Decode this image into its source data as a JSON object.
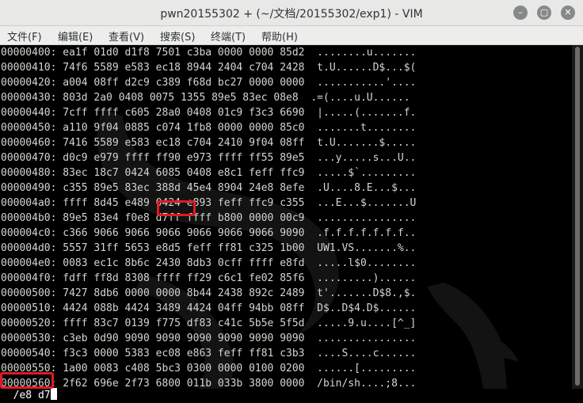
{
  "window": {
    "title": "pwn20155302 + (~/文档/20155302/exp1) - VIM"
  },
  "controls": {
    "minimize": "–",
    "maximize": "▢",
    "close": "✕"
  },
  "menu": [
    "文件(F)",
    "编辑(E)",
    "查看(V)",
    "搜索(S)",
    "终端(T)",
    "帮助(H)"
  ],
  "hexdump": [
    "00000400: ea1f 01d0 d1f8 7501 c3ba 0000 0000 85d2  ........u.......",
    "00000410: 74f6 5589 e583 ec18 8944 2404 c704 2428  t.U......D$...$(",
    "00000420: a004 08ff d2c9 c389 f68d bc27 0000 0000  ...........'....",
    "00000430: 803d 2a0 0408 0075 1355 89e5 83ec 08e8  .=(....u.U......",
    "00000440: 7cff ffff c605 28a0 0408 01c9 f3c3 6690  |.....(.......f.",
    "00000450: a110 9f04 0885 c074 1fb8 0000 0000 85c0  .......t........",
    "00000460: 7416 5589 e583 ec18 c704 2410 9f04 08ff  t.U.......$.....",
    "00000470: d0c9 e979 ffff ff90 e973 ffff ff55 89e5  ...y.....s...U..",
    "00000480: 83ec 18c7 0424 6085 0408 e8c1 feff ffc9  .....$`.........",
    "00000490: c355 89e5 83ec 388d 45e4 8904 24e8 8efe  .U....8.E...$...",
    "000004a0: ffff 8d45 e489 0424 e893 feff ffc9 c355  ...E...$.......U",
    "000004b0: 89e5 83e4 f0e8 d7ff ffff b800 0000 00c9  ................",
    "000004c0: c366 9066 9066 9066 9066 9066 9066 9090  .f.f.f.f.f.f.f..",
    "000004d0: 5557 31ff 5653 e8d5 feff ff81 c325 1b00  UW1.VS.......%..",
    "000004e0: 0083 ec1c 8b6c 2430 8db3 0cff ffff e8fd  .....l$0........",
    "000004f0: fdff ff8d 8308 ffff ff29 c6c1 fe02 85f6  .........)......",
    "00000500: 7427 8db6 0000 0000 8b44 2438 892c 2489  t'.......D$8.,$.",
    "00000510: 4424 088b 4424 3489 4424 04ff 94bb 08ff  D$..D$4.D$......",
    "00000520: ffff 83c7 0139 f775 df83 c41c 5b5e 5f5d  .....9.u....[^_]",
    "00000530: c3eb 0d90 9090 9090 9090 9090 9090 9090  ................",
    "00000540: f3c3 0000 5383 ec08 e863 feff ff81 c3b3  ....S....c......",
    "00000550: 1a00 0083 c408 5bc3 0300 0000 0100 0200  ......[.........",
    "00000560: 2f62 696e 2f73 6800 011b 033b 3800 0000  /bin/sh....;8..."
  ],
  "command": "/e8 d7"
}
